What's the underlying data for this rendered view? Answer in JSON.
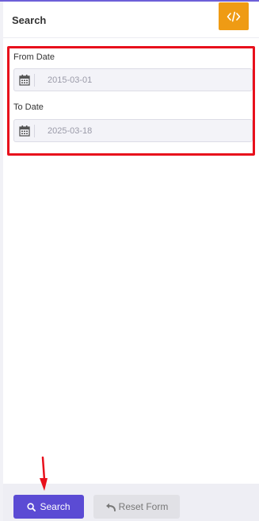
{
  "header": {
    "title": "Search",
    "code_icon": "code-icon"
  },
  "form": {
    "from_date": {
      "label": "From Date",
      "value": "2015-03-01",
      "icon": "calendar-icon"
    },
    "to_date": {
      "label": "To Date",
      "value": "2025-03-18",
      "icon": "calendar-icon"
    }
  },
  "footer": {
    "search_label": "Search",
    "search_icon": "search-icon",
    "reset_label": "Reset Form",
    "reset_icon": "undo-icon"
  },
  "colors": {
    "accent": "#5b4bd4",
    "code_button": "#ef9b14",
    "highlight": "#e8101c"
  }
}
